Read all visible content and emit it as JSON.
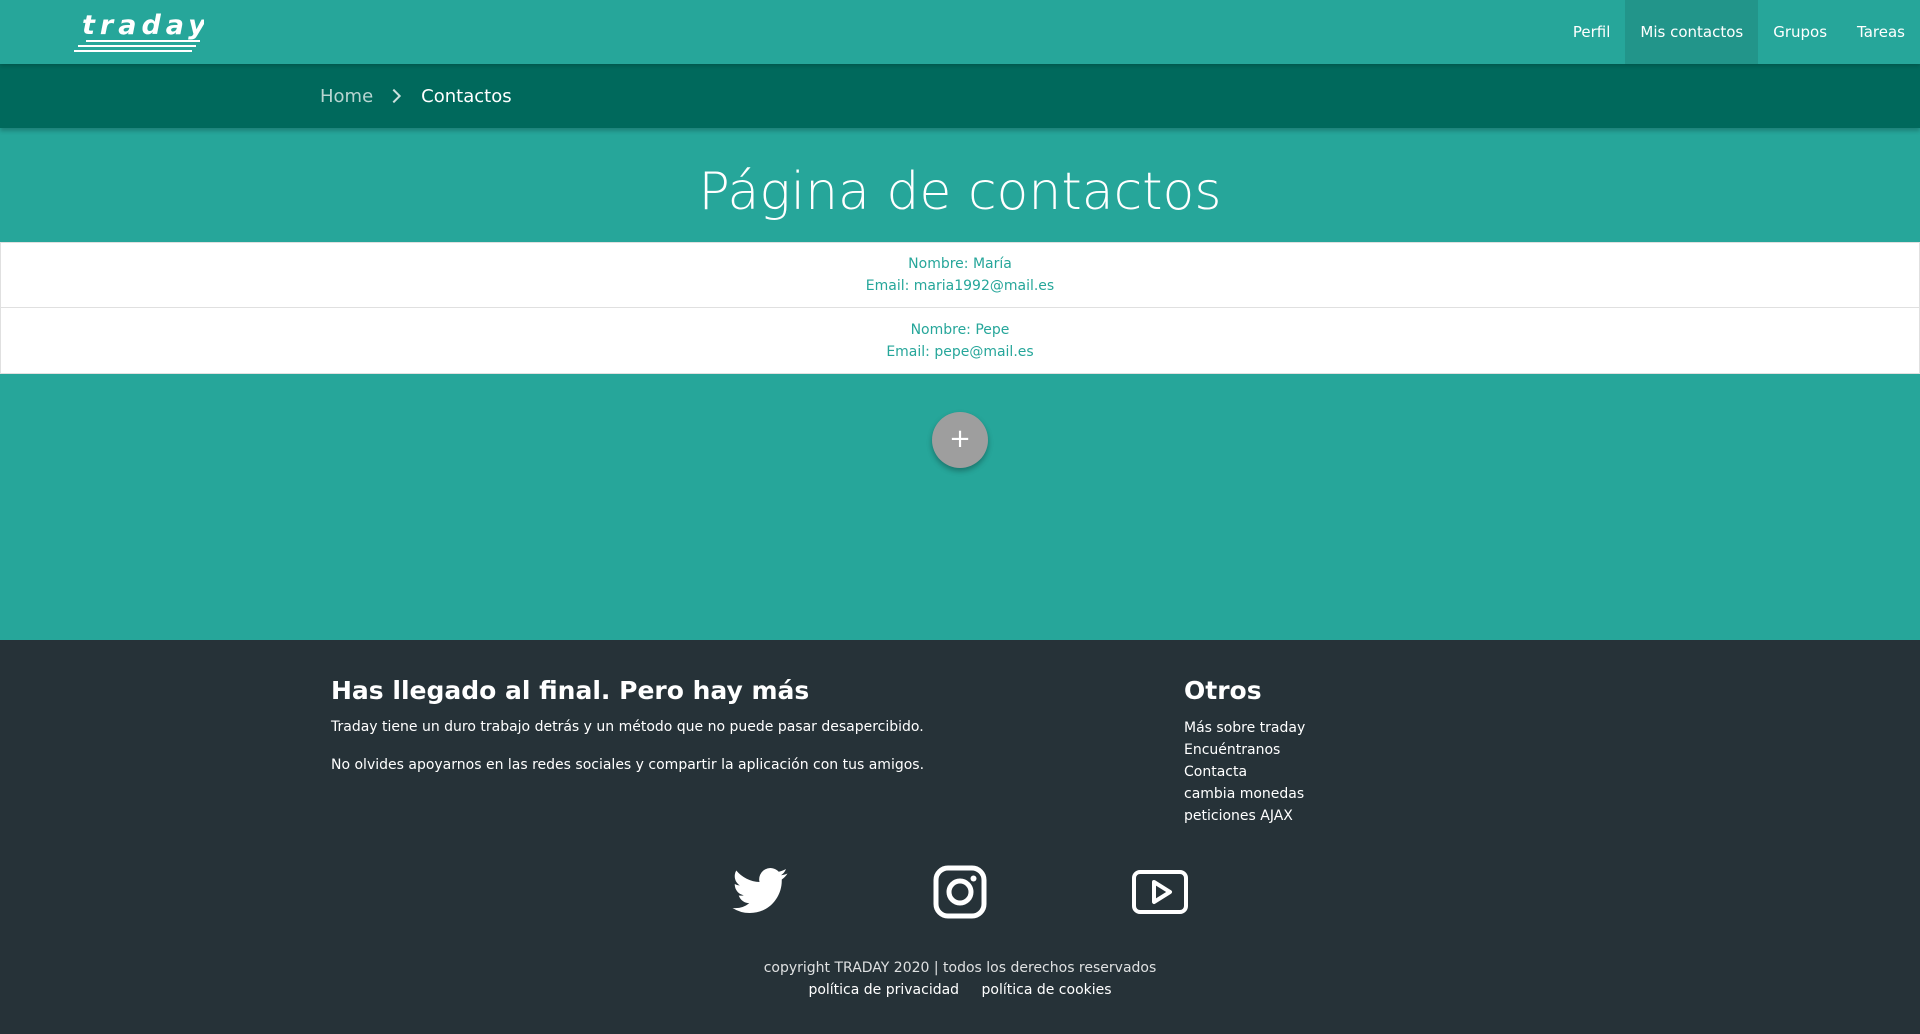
{
  "brand": {
    "logo_text": "traday"
  },
  "nav": {
    "items": [
      {
        "label": "Perfil"
      },
      {
        "label": "Mis contactos",
        "active": true
      },
      {
        "label": "Grupos"
      },
      {
        "label": "Tareas"
      }
    ]
  },
  "breadcrumb": {
    "home": "Home",
    "current": "Contactos"
  },
  "page": {
    "title": "Página de contactos"
  },
  "contacts": [
    {
      "name": "Nombre: María",
      "email": "Email: maria1992@mail.es"
    },
    {
      "name": "Nombre: Pepe",
      "email": "Email: pepe@mail.es"
    }
  ],
  "fab": {
    "label": "+"
  },
  "footer": {
    "left": {
      "title": "Has llegado al final. Pero hay más",
      "text1": "Traday tiene un duro trabajo detrás y un método que no puede pasar desapercibido.",
      "text2": "No olvides apoyarnos en las redes sociales y compartir la aplicación con tus amigos."
    },
    "right": {
      "title": "Otros",
      "links": [
        "Más sobre traday",
        "Encuéntranos",
        "Contacta",
        "cambia monedas",
        "peticiones AJAX"
      ]
    },
    "social": [
      "twitter-icon",
      "instagram-icon",
      "youtube-icon"
    ],
    "copyright": "copyright TRADAY 2020 | todos los derechos reservados",
    "legal": [
      "política de privacidad",
      "política de cookies"
    ]
  },
  "colors": {
    "primary": "#26a69a",
    "dark_teal": "#00695c",
    "footer_bg": "#263238",
    "fab_bg": "#9e9e9e",
    "list_text": "#26a69a"
  }
}
